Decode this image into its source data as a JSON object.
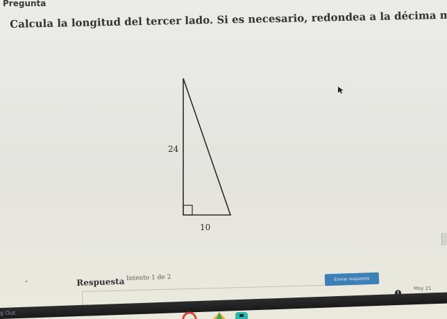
{
  "section_label": "Pregunta",
  "question": "Calcula la longitud del tercer lado. Si es necesario, redondea a la décima más cercana.",
  "figure": {
    "side_vertical": "24",
    "side_horizontal": "10"
  },
  "answer": {
    "title": "Respuesta",
    "attempt": "Intento 1 de 2",
    "submit_label": "Enviar respuesta",
    "input_value": ""
  },
  "status": {
    "date": "May 21"
  },
  "sidebar": {
    "logout_label": "g Out"
  },
  "colors": {
    "submit_button": "#3f7fb8",
    "triangle_stroke": "#2a2a2a"
  }
}
